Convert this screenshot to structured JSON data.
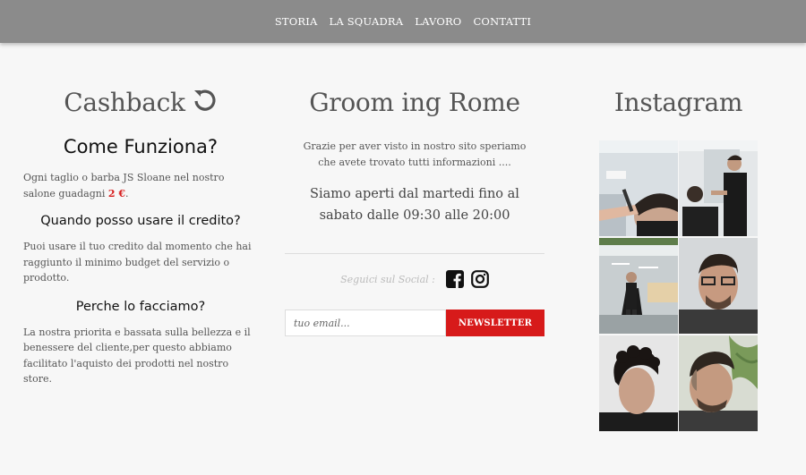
{
  "nav": {
    "items": [
      "STORIA",
      "LA SQUADRA",
      "LAVORO",
      "CONTATTI"
    ]
  },
  "cashback": {
    "title": "Cashback",
    "subtitle": "Come Funziona?",
    "p1_text": "Ogni taglio o barba JS Sloane nel nostro salone guadagni ",
    "p1_amount": "2 €",
    "p1_end": ".",
    "q2": "Quando posso usare il credito?",
    "p2": "Puoi usare il tuo credito dal momento che hai raggiunto il minimo budget del servizio o prodotto.",
    "q3": "Perche lo facciamo?",
    "p3": "La nostra priorita e bassata sulla bellezza e il benessere del cliente,per questo abbiamo facilitato l'aquisto dei prodotti nel nostro store."
  },
  "grooming": {
    "title": "Groom ing Rome",
    "intro": "Grazie per aver visto in nostro sito speriamo che avete trovato tutti informazioni ....",
    "open_line1": "Siamo aperti dal martedi fino al",
    "open_line2": "sabato dalle 09:30 alle 20:00",
    "social_label": "Seguici sul Social :",
    "email_placeholder": "tuo email...",
    "newsletter_button": "NEWSLETTER"
  },
  "instagram": {
    "title": "Instagram"
  },
  "colors": {
    "accent": "#d71a1a",
    "nav_bg": "#8b8b8b",
    "page_bg": "#f7f7f7"
  }
}
